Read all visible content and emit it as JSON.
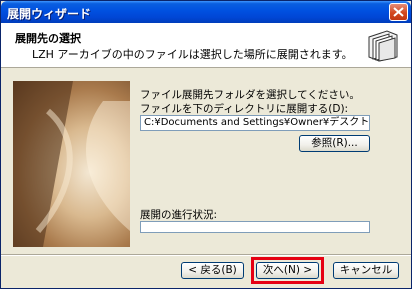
{
  "window": {
    "title": "展開ウィザード"
  },
  "header": {
    "title": "展開先の選択",
    "subtitle": "LZH アーカイブの中のファイルは選択した場所に展開されます。",
    "icon": "folder-stack-icon"
  },
  "main": {
    "instruction": "ファイル展開先フォルダを選択してください。",
    "dir_label": "ファイルを下のディレクトリに展開する(D):",
    "dir_value": "C:¥Documents and Settings¥Owner¥デスクトップ",
    "browse_label": "参照(R)...",
    "progress_label": "展開の進行状況:",
    "progress_value": 0
  },
  "footer": {
    "back_label": "< 戻る(B)",
    "next_label": "次へ(N) >",
    "cancel_label": "キャンセル"
  },
  "colors": {
    "titlebar": "#0050e0",
    "highlight": "#e60012",
    "dialog_bg": "#ece9d8"
  }
}
